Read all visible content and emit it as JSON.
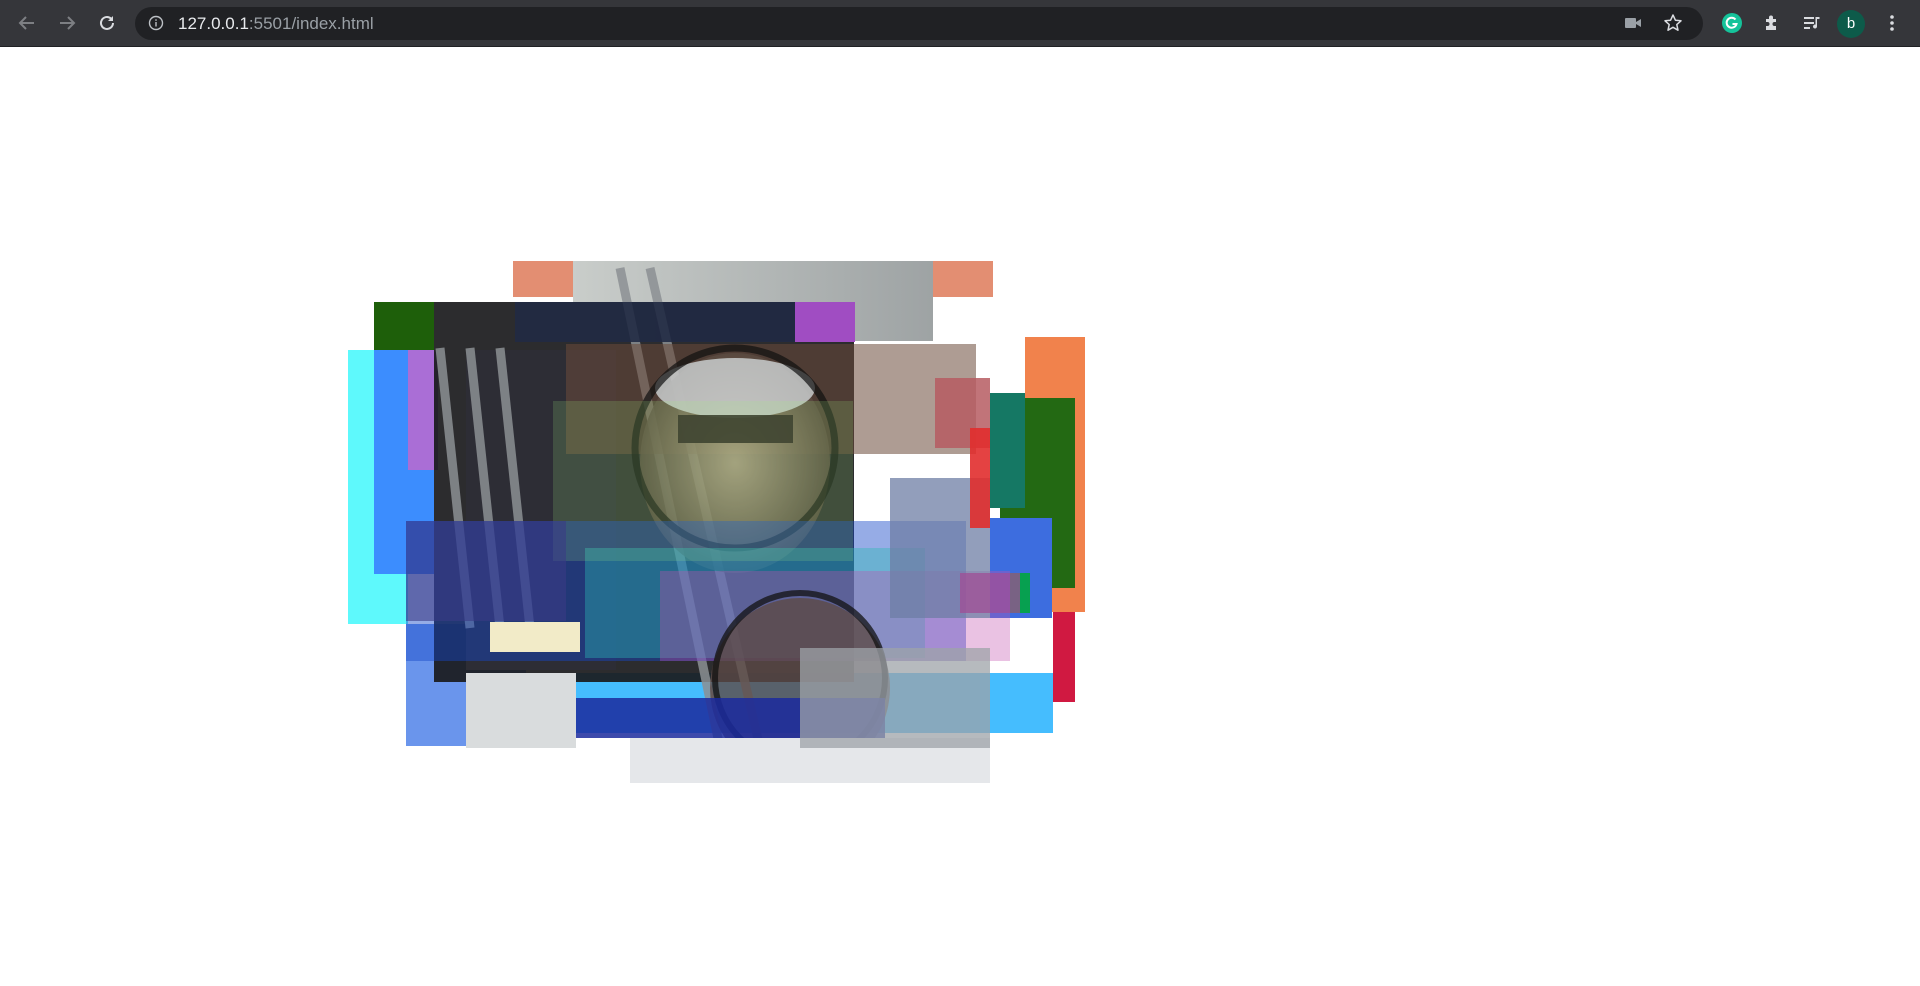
{
  "browser": {
    "url_host": "127.0.0.1",
    "url_path": ":5501/index.html",
    "profile_initial": "b",
    "icons": {
      "back": "arrow-left-icon",
      "forward": "arrow-right-icon",
      "reload": "reload-icon",
      "site_info": "info-icon",
      "camera": "video-camera-icon",
      "bookmark": "star-icon",
      "grammarly": "grammarly-icon",
      "extensions": "puzzle-icon",
      "media": "media-queue-icon",
      "menu": "kebab-menu-icon"
    },
    "colors": {
      "toolbar": "#35363a",
      "omnibox": "#202124",
      "grammarly": "#15c39a",
      "avatar": "#0d5b4a"
    }
  },
  "artwork": {
    "description_colors": [
      "#e38e72",
      "#1e5f0a",
      "#5ef9fc",
      "#3c8dfe",
      "#6a95ec",
      "#45bdfe",
      "#f1824c",
      "#d01941",
      "#236913",
      "#aa6ed6"
    ]
  }
}
